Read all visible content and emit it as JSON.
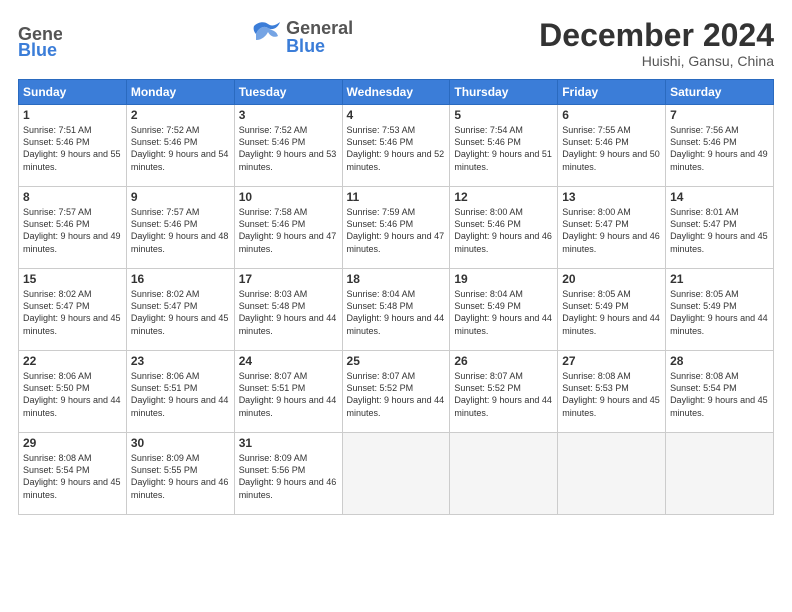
{
  "header": {
    "logo_line1": "General",
    "logo_line2": "Blue",
    "month": "December 2024",
    "location": "Huishi, Gansu, China"
  },
  "weekdays": [
    "Sunday",
    "Monday",
    "Tuesday",
    "Wednesday",
    "Thursday",
    "Friday",
    "Saturday"
  ],
  "weeks": [
    [
      {
        "day": "1",
        "sunrise": "Sunrise: 7:51 AM",
        "sunset": "Sunset: 5:46 PM",
        "daylight": "Daylight: 9 hours and 55 minutes."
      },
      {
        "day": "2",
        "sunrise": "Sunrise: 7:52 AM",
        "sunset": "Sunset: 5:46 PM",
        "daylight": "Daylight: 9 hours and 54 minutes."
      },
      {
        "day": "3",
        "sunrise": "Sunrise: 7:52 AM",
        "sunset": "Sunset: 5:46 PM",
        "daylight": "Daylight: 9 hours and 53 minutes."
      },
      {
        "day": "4",
        "sunrise": "Sunrise: 7:53 AM",
        "sunset": "Sunset: 5:46 PM",
        "daylight": "Daylight: 9 hours and 52 minutes."
      },
      {
        "day": "5",
        "sunrise": "Sunrise: 7:54 AM",
        "sunset": "Sunset: 5:46 PM",
        "daylight": "Daylight: 9 hours and 51 minutes."
      },
      {
        "day": "6",
        "sunrise": "Sunrise: 7:55 AM",
        "sunset": "Sunset: 5:46 PM",
        "daylight": "Daylight: 9 hours and 50 minutes."
      },
      {
        "day": "7",
        "sunrise": "Sunrise: 7:56 AM",
        "sunset": "Sunset: 5:46 PM",
        "daylight": "Daylight: 9 hours and 49 minutes."
      }
    ],
    [
      {
        "day": "8",
        "sunrise": "Sunrise: 7:57 AM",
        "sunset": "Sunset: 5:46 PM",
        "daylight": "Daylight: 9 hours and 49 minutes."
      },
      {
        "day": "9",
        "sunrise": "Sunrise: 7:57 AM",
        "sunset": "Sunset: 5:46 PM",
        "daylight": "Daylight: 9 hours and 48 minutes."
      },
      {
        "day": "10",
        "sunrise": "Sunrise: 7:58 AM",
        "sunset": "Sunset: 5:46 PM",
        "daylight": "Daylight: 9 hours and 47 minutes."
      },
      {
        "day": "11",
        "sunrise": "Sunrise: 7:59 AM",
        "sunset": "Sunset: 5:46 PM",
        "daylight": "Daylight: 9 hours and 47 minutes."
      },
      {
        "day": "12",
        "sunrise": "Sunrise: 8:00 AM",
        "sunset": "Sunset: 5:46 PM",
        "daylight": "Daylight: 9 hours and 46 minutes."
      },
      {
        "day": "13",
        "sunrise": "Sunrise: 8:00 AM",
        "sunset": "Sunset: 5:47 PM",
        "daylight": "Daylight: 9 hours and 46 minutes."
      },
      {
        "day": "14",
        "sunrise": "Sunrise: 8:01 AM",
        "sunset": "Sunset: 5:47 PM",
        "daylight": "Daylight: 9 hours and 45 minutes."
      }
    ],
    [
      {
        "day": "15",
        "sunrise": "Sunrise: 8:02 AM",
        "sunset": "Sunset: 5:47 PM",
        "daylight": "Daylight: 9 hours and 45 minutes."
      },
      {
        "day": "16",
        "sunrise": "Sunrise: 8:02 AM",
        "sunset": "Sunset: 5:47 PM",
        "daylight": "Daylight: 9 hours and 45 minutes."
      },
      {
        "day": "17",
        "sunrise": "Sunrise: 8:03 AM",
        "sunset": "Sunset: 5:48 PM",
        "daylight": "Daylight: 9 hours and 44 minutes."
      },
      {
        "day": "18",
        "sunrise": "Sunrise: 8:04 AM",
        "sunset": "Sunset: 5:48 PM",
        "daylight": "Daylight: 9 hours and 44 minutes."
      },
      {
        "day": "19",
        "sunrise": "Sunrise: 8:04 AM",
        "sunset": "Sunset: 5:49 PM",
        "daylight": "Daylight: 9 hours and 44 minutes."
      },
      {
        "day": "20",
        "sunrise": "Sunrise: 8:05 AM",
        "sunset": "Sunset: 5:49 PM",
        "daylight": "Daylight: 9 hours and 44 minutes."
      },
      {
        "day": "21",
        "sunrise": "Sunrise: 8:05 AM",
        "sunset": "Sunset: 5:49 PM",
        "daylight": "Daylight: 9 hours and 44 minutes."
      }
    ],
    [
      {
        "day": "22",
        "sunrise": "Sunrise: 8:06 AM",
        "sunset": "Sunset: 5:50 PM",
        "daylight": "Daylight: 9 hours and 44 minutes."
      },
      {
        "day": "23",
        "sunrise": "Sunrise: 8:06 AM",
        "sunset": "Sunset: 5:51 PM",
        "daylight": "Daylight: 9 hours and 44 minutes."
      },
      {
        "day": "24",
        "sunrise": "Sunrise: 8:07 AM",
        "sunset": "Sunset: 5:51 PM",
        "daylight": "Daylight: 9 hours and 44 minutes."
      },
      {
        "day": "25",
        "sunrise": "Sunrise: 8:07 AM",
        "sunset": "Sunset: 5:52 PM",
        "daylight": "Daylight: 9 hours and 44 minutes."
      },
      {
        "day": "26",
        "sunrise": "Sunrise: 8:07 AM",
        "sunset": "Sunset: 5:52 PM",
        "daylight": "Daylight: 9 hours and 44 minutes."
      },
      {
        "day": "27",
        "sunrise": "Sunrise: 8:08 AM",
        "sunset": "Sunset: 5:53 PM",
        "daylight": "Daylight: 9 hours and 45 minutes."
      },
      {
        "day": "28",
        "sunrise": "Sunrise: 8:08 AM",
        "sunset": "Sunset: 5:54 PM",
        "daylight": "Daylight: 9 hours and 45 minutes."
      }
    ],
    [
      {
        "day": "29",
        "sunrise": "Sunrise: 8:08 AM",
        "sunset": "Sunset: 5:54 PM",
        "daylight": "Daylight: 9 hours and 45 minutes."
      },
      {
        "day": "30",
        "sunrise": "Sunrise: 8:09 AM",
        "sunset": "Sunset: 5:55 PM",
        "daylight": "Daylight: 9 hours and 46 minutes."
      },
      {
        "day": "31",
        "sunrise": "Sunrise: 8:09 AM",
        "sunset": "Sunset: 5:56 PM",
        "daylight": "Daylight: 9 hours and 46 minutes."
      },
      null,
      null,
      null,
      null
    ]
  ]
}
